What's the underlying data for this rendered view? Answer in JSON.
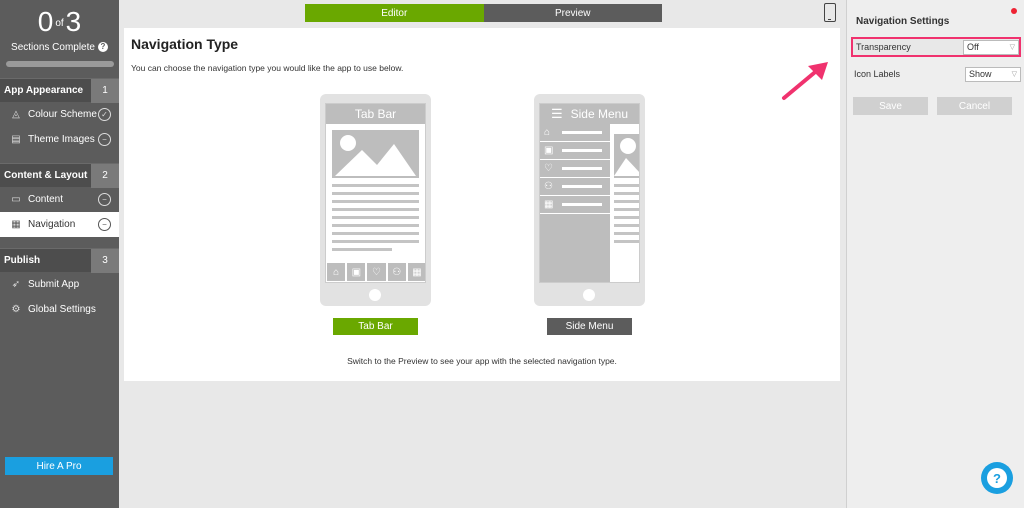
{
  "sidebar": {
    "progress": {
      "completed": "0",
      "of_label": "of",
      "total": "3",
      "label": "Sections Complete",
      "help_glyph": "?"
    },
    "sections": [
      {
        "title": "App Appearance",
        "number": "1",
        "items": [
          {
            "label": "Colour Scheme",
            "icon": "paint-bucket-icon",
            "status": "complete"
          },
          {
            "label": "Theme Images",
            "icon": "image-file-icon",
            "status": "incomplete"
          }
        ]
      },
      {
        "title": "Content & Layout",
        "number": "2",
        "items": [
          {
            "label": "Content",
            "icon": "content-list-icon",
            "status": "incomplete"
          },
          {
            "label": "Navigation",
            "icon": "navigation-layout-icon",
            "status": "incomplete",
            "active": true
          }
        ]
      },
      {
        "title": "Publish",
        "number": "3",
        "items": [
          {
            "label": "Submit App",
            "icon": "rocket-icon",
            "status": "none"
          },
          {
            "label": "Global Settings",
            "icon": "gears-icon",
            "status": "none"
          }
        ]
      }
    ],
    "hire_label": "Hire A Pro"
  },
  "tabs": {
    "editor": "Editor",
    "preview": "Preview"
  },
  "main": {
    "title": "Navigation Type",
    "description": "You can choose the navigation type you would like the app to use below.",
    "tabbar_title": "Tab Bar",
    "sidemenu_title": "Side Menu",
    "tabbar_button": "Tab Bar",
    "sidemenu_button": "Side Menu",
    "footnote": "Switch to the Preview to see your app with the selected navigation type."
  },
  "settings": {
    "title": "Navigation Settings",
    "transparency_label": "Transparency",
    "transparency_value": "Off",
    "icon_labels_label": "Icon Labels",
    "icon_labels_value": "Show",
    "save_label": "Save",
    "cancel_label": "Cancel"
  },
  "colors": {
    "accent_green": "#6aa800",
    "sidebar": "#5c5c5c",
    "highlight": "#f0326e",
    "help_blue": "#1a9fe0"
  }
}
